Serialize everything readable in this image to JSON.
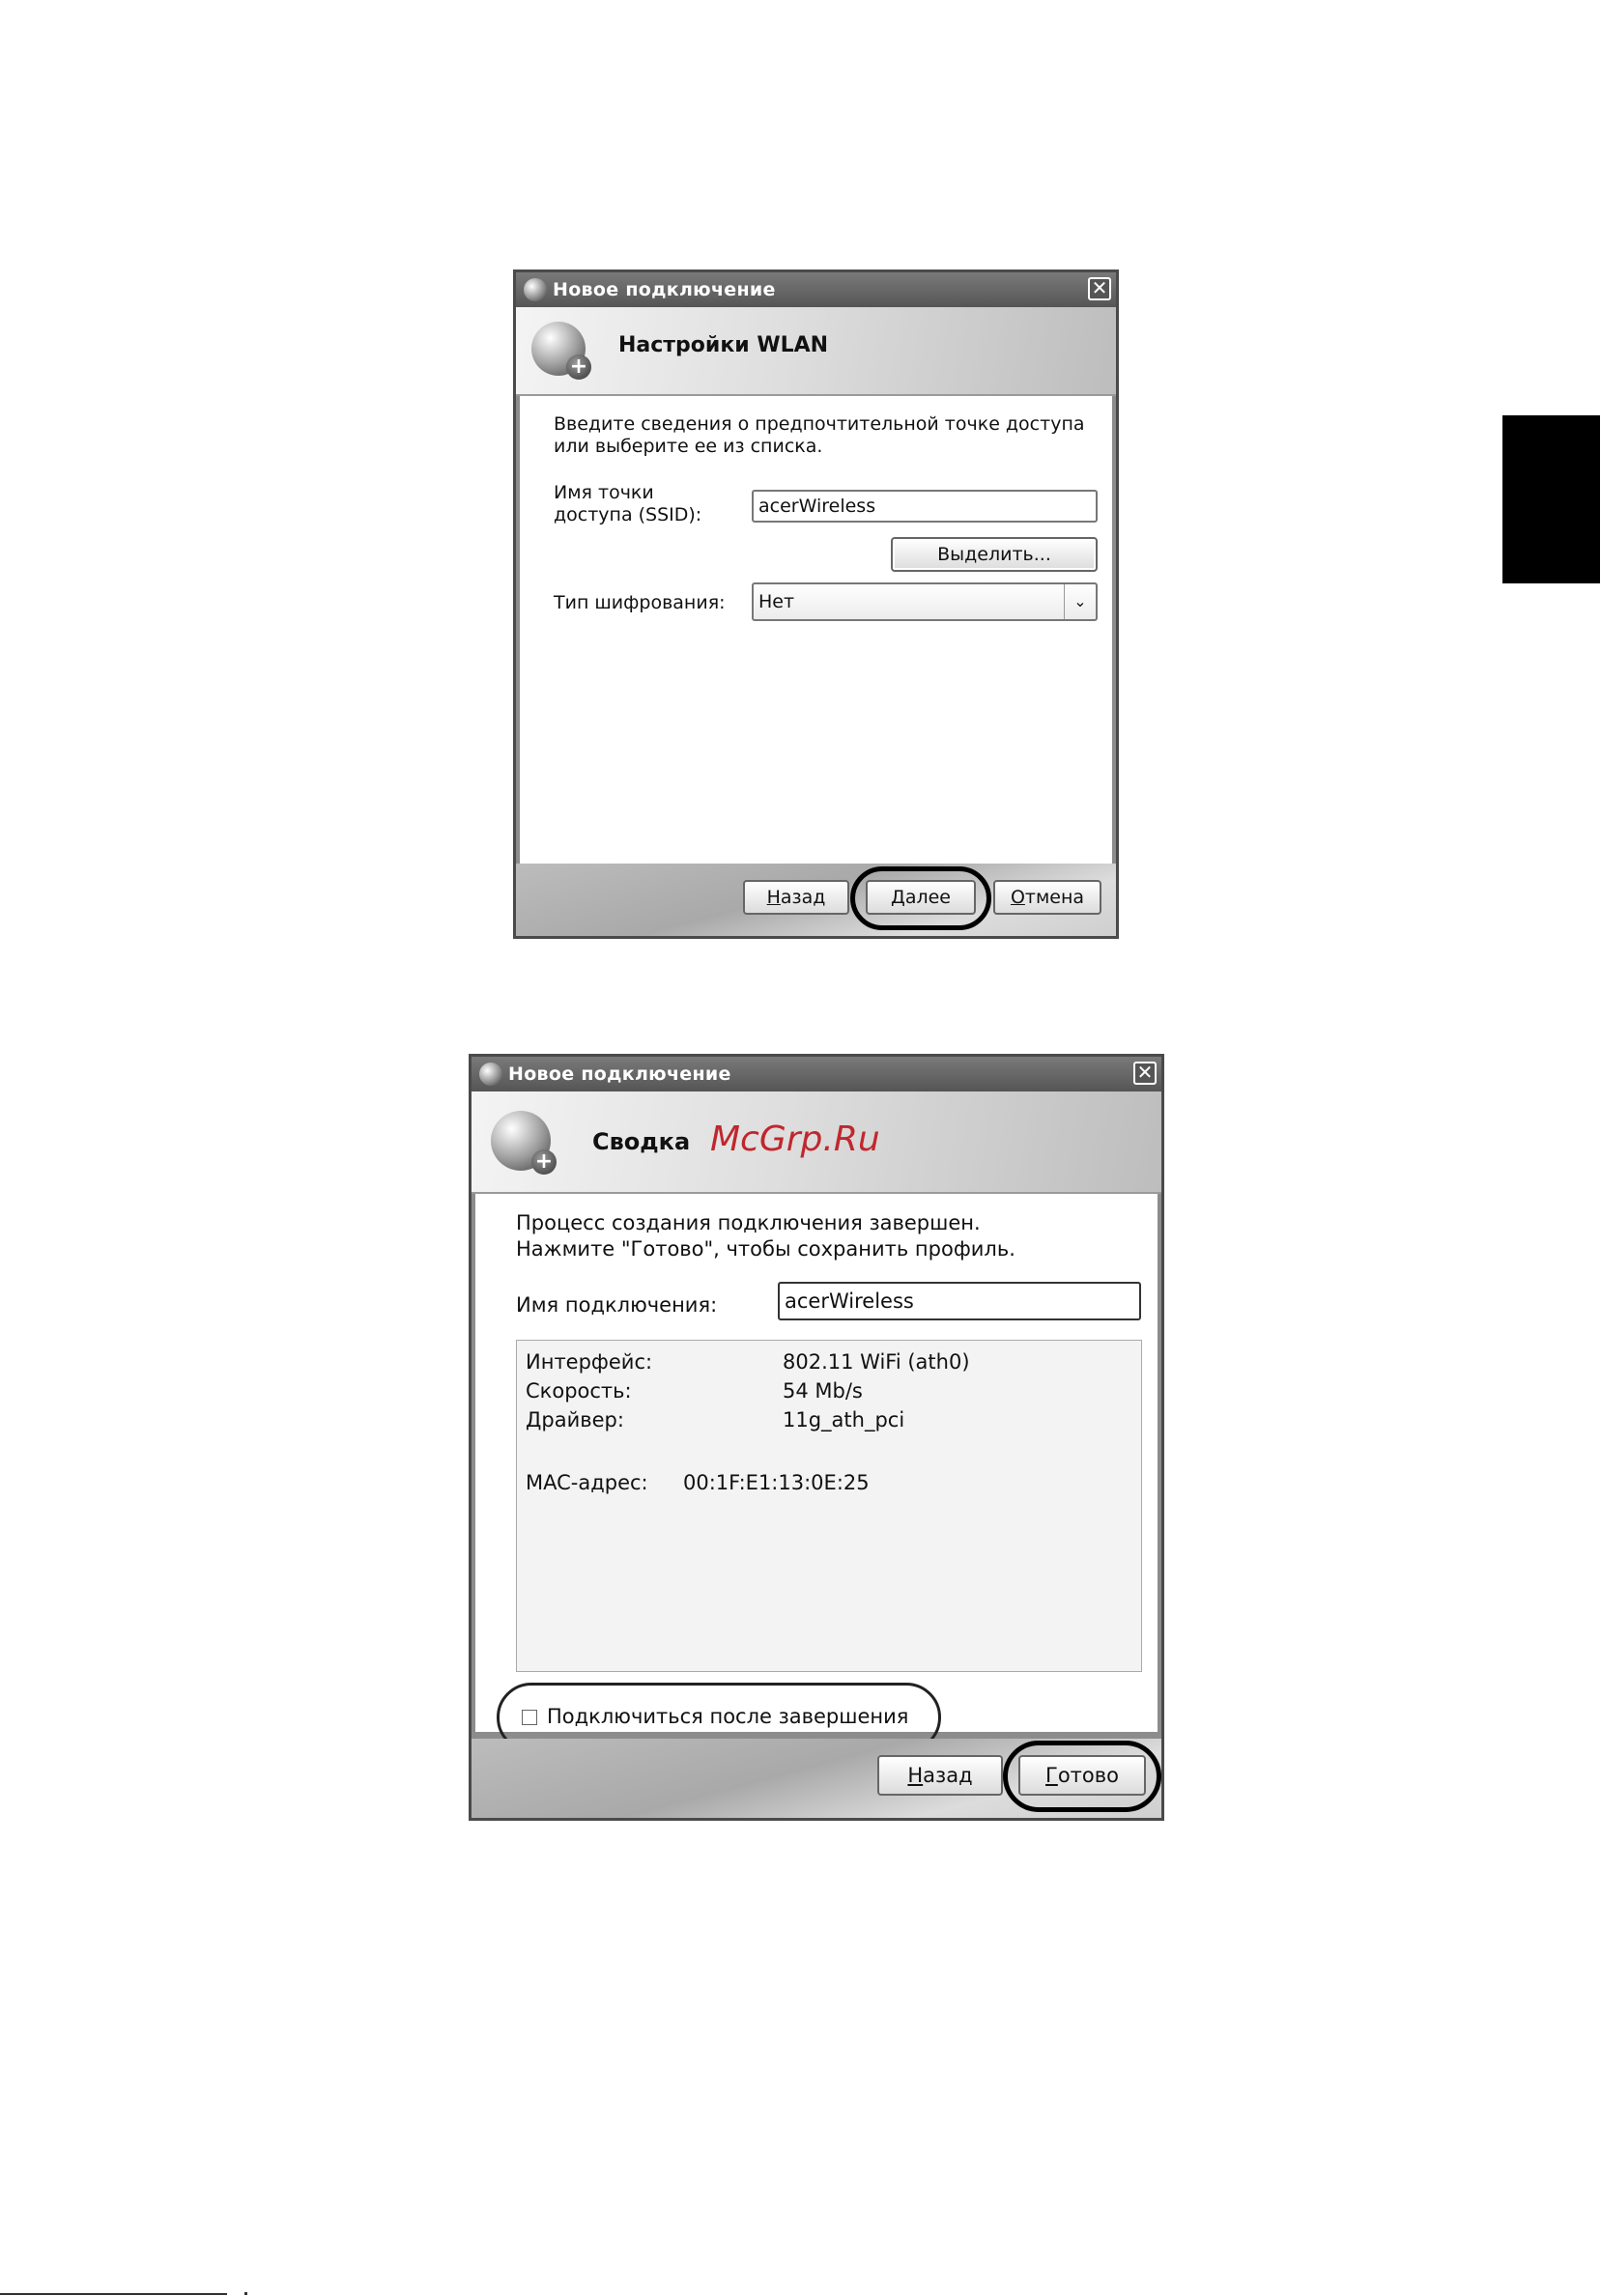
{
  "dialog1": {
    "window_title": "Новое подключение",
    "header_title": "Настройки WLAN",
    "intro_line1": "Введите сведения о предпочтительной точке доступа",
    "intro_line2": "или выберите ее из списка.",
    "ssid_label_line1": "Имя точки",
    "ssid_label_line2": "доступа (SSID):",
    "ssid_value": "acerWireless",
    "select_button": "Выделить...",
    "encryption_label": "Тип шифрования:",
    "encryption_value": "Нет",
    "back_button": {
      "mnemonic": "Н",
      "rest": "азад"
    },
    "next_button": {
      "mnemonic": "Д",
      "rest": "алее"
    },
    "cancel_button": {
      "mnemonic": "О",
      "rest": "тмена"
    }
  },
  "dialog2": {
    "window_title": "Новое подключение",
    "header_title": "Сводка",
    "watermark": "McGrp.Ru",
    "intro_line1": "Процесс создания подключения завершен.",
    "intro_line2": "Нажмите \"Готово\", чтобы сохранить профиль.",
    "connection_name_label": "Имя подключения:",
    "connection_name_value": "acerWireless",
    "details": {
      "interface_label": "Интерфейс:",
      "interface_value": "802.11 WiFi (ath0)",
      "speed_label": "Скорость:",
      "speed_value": "54 Mb/s",
      "driver_label": "Драйвер:",
      "driver_value": "11g_ath_pci",
      "mac_label": "MAC-адрес:",
      "mac_value": "00:1F:E1:13:0E:25"
    },
    "connect_checkbox_label": "Подключиться после завершения",
    "connect_checked": false,
    "back_button": {
      "mnemonic": "Н",
      "rest": "азад"
    },
    "finish_button": {
      "mnemonic": "Г",
      "rest": "отово"
    }
  },
  "icons": [
    "network-globe-icon",
    "close-icon",
    "chevron-down-icon",
    "plus-icon"
  ]
}
